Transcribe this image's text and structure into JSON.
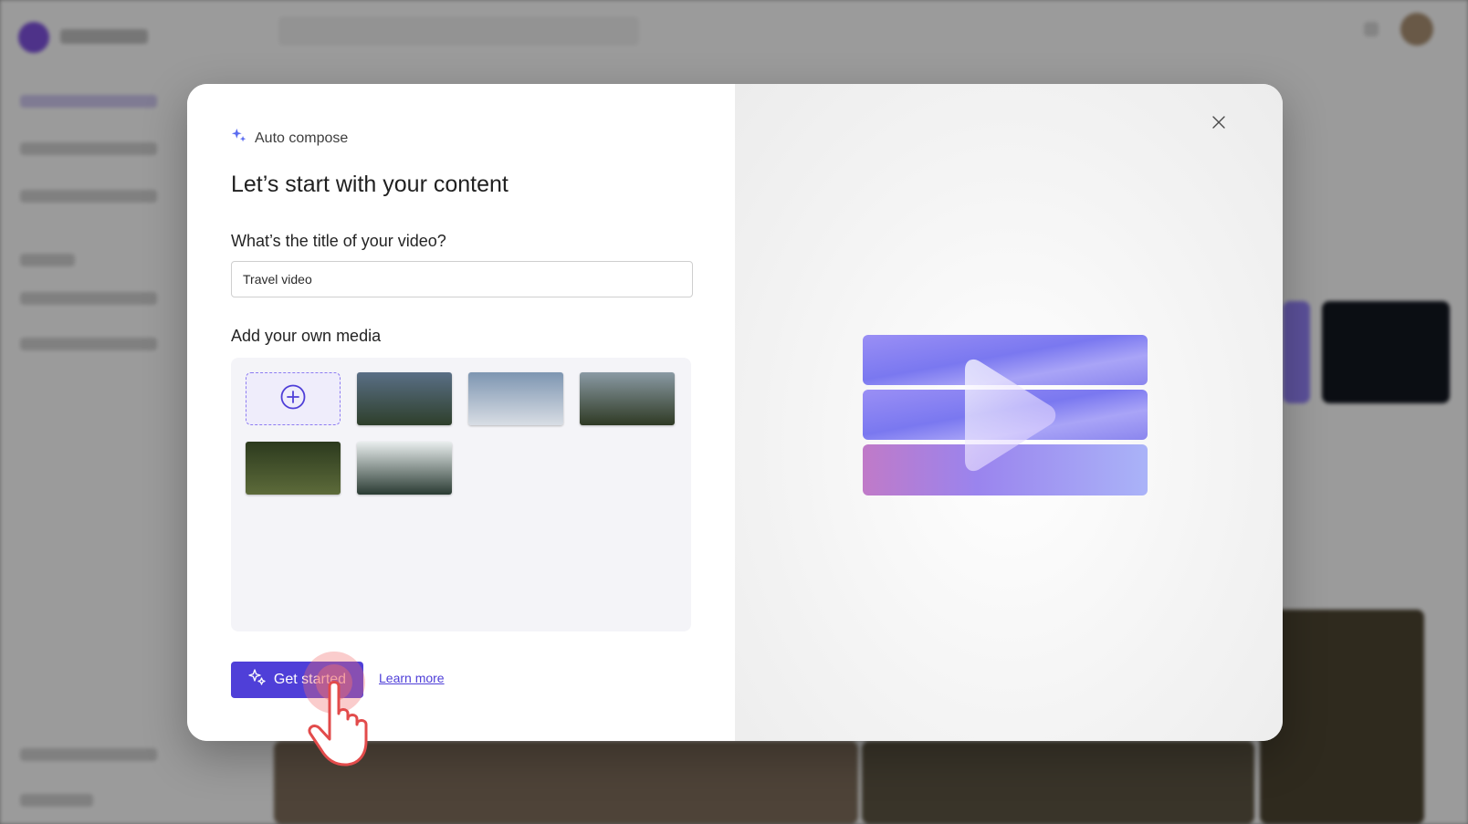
{
  "modal": {
    "eyebrow": "Auto compose",
    "title": "Let’s start with your content",
    "video_title_label": "What’s the title of your video?",
    "video_title_value": "Travel video",
    "media_label": "Add your own media",
    "media_items": [
      {
        "name": "mountain-lake-forest",
        "row": 0,
        "col": 1,
        "top": "#5a6f86",
        "bottom": "#2e3f2b"
      },
      {
        "name": "snowy-mountain-ridge",
        "row": 0,
        "col": 2,
        "top": "#7d95b1",
        "bottom": "#d8dde4"
      },
      {
        "name": "green-mountain-summit",
        "row": 0,
        "col": 3,
        "top": "#8a9aa4",
        "bottom": "#2f3a24"
      },
      {
        "name": "forest-river-canyon",
        "row": 1,
        "col": 0,
        "top": "#2c3a1e",
        "bottom": "#5d6b3a"
      },
      {
        "name": "snowy-forest-aerial",
        "row": 1,
        "col": 1,
        "top": "#e9eeee",
        "bottom": "#2a3b33"
      }
    ],
    "get_started_label": "Get started",
    "learn_more_label": "Learn more"
  },
  "icons": {
    "eyebrow": "sparkle-icon",
    "add_media": "plus-circle-icon",
    "get_started": "sparkle-icon",
    "close": "close-icon",
    "cursor": "hand-pointer-icon"
  },
  "colors": {
    "accent": "#4f3fd8",
    "accent_light": "#8d7cf2",
    "sparkle": "#5b6cf0",
    "cursor_highlight": "#f06e6e"
  }
}
